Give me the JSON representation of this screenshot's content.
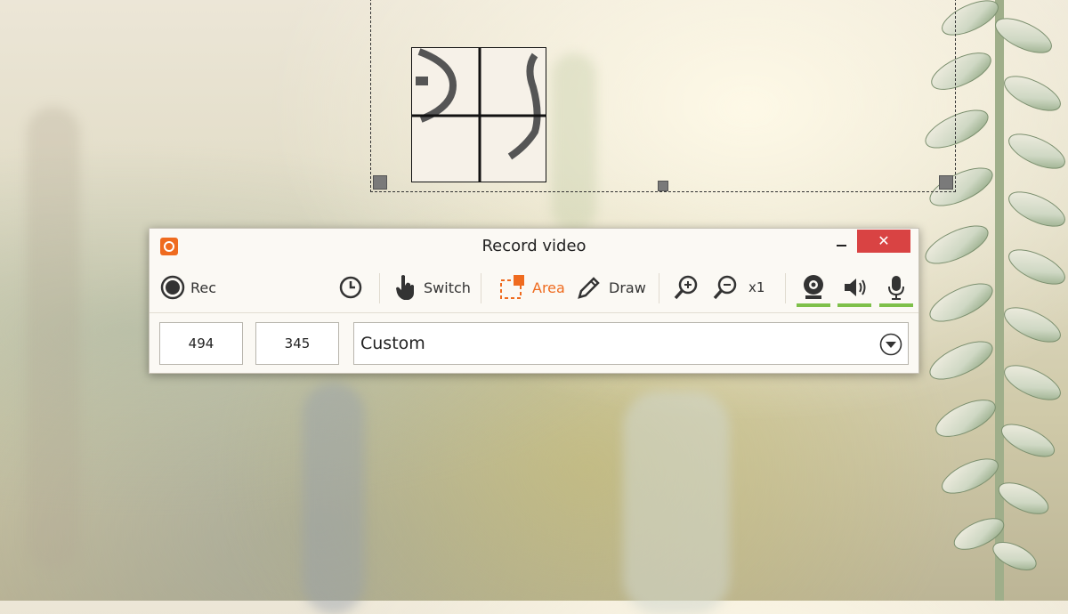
{
  "window": {
    "title": "Record video",
    "close_glyph": "✕"
  },
  "toolbar": {
    "rec_label": "Rec",
    "switch_label": "Switch",
    "area_label": "Area",
    "draw_label": "Draw",
    "zoom_level": "x1",
    "accent_color": "#ef6b1f",
    "active_status_color": "#7ec04a"
  },
  "fields": {
    "width": "494",
    "height": "345",
    "preset": "Custom"
  },
  "icons": [
    "app-logo-icon",
    "record-icon",
    "timer-icon",
    "hand-pointer-icon",
    "area-select-icon",
    "pencil-icon",
    "zoom-in-icon",
    "zoom-out-icon",
    "webcam-icon",
    "speaker-icon",
    "microphone-icon",
    "dropdown-arrow-icon"
  ]
}
